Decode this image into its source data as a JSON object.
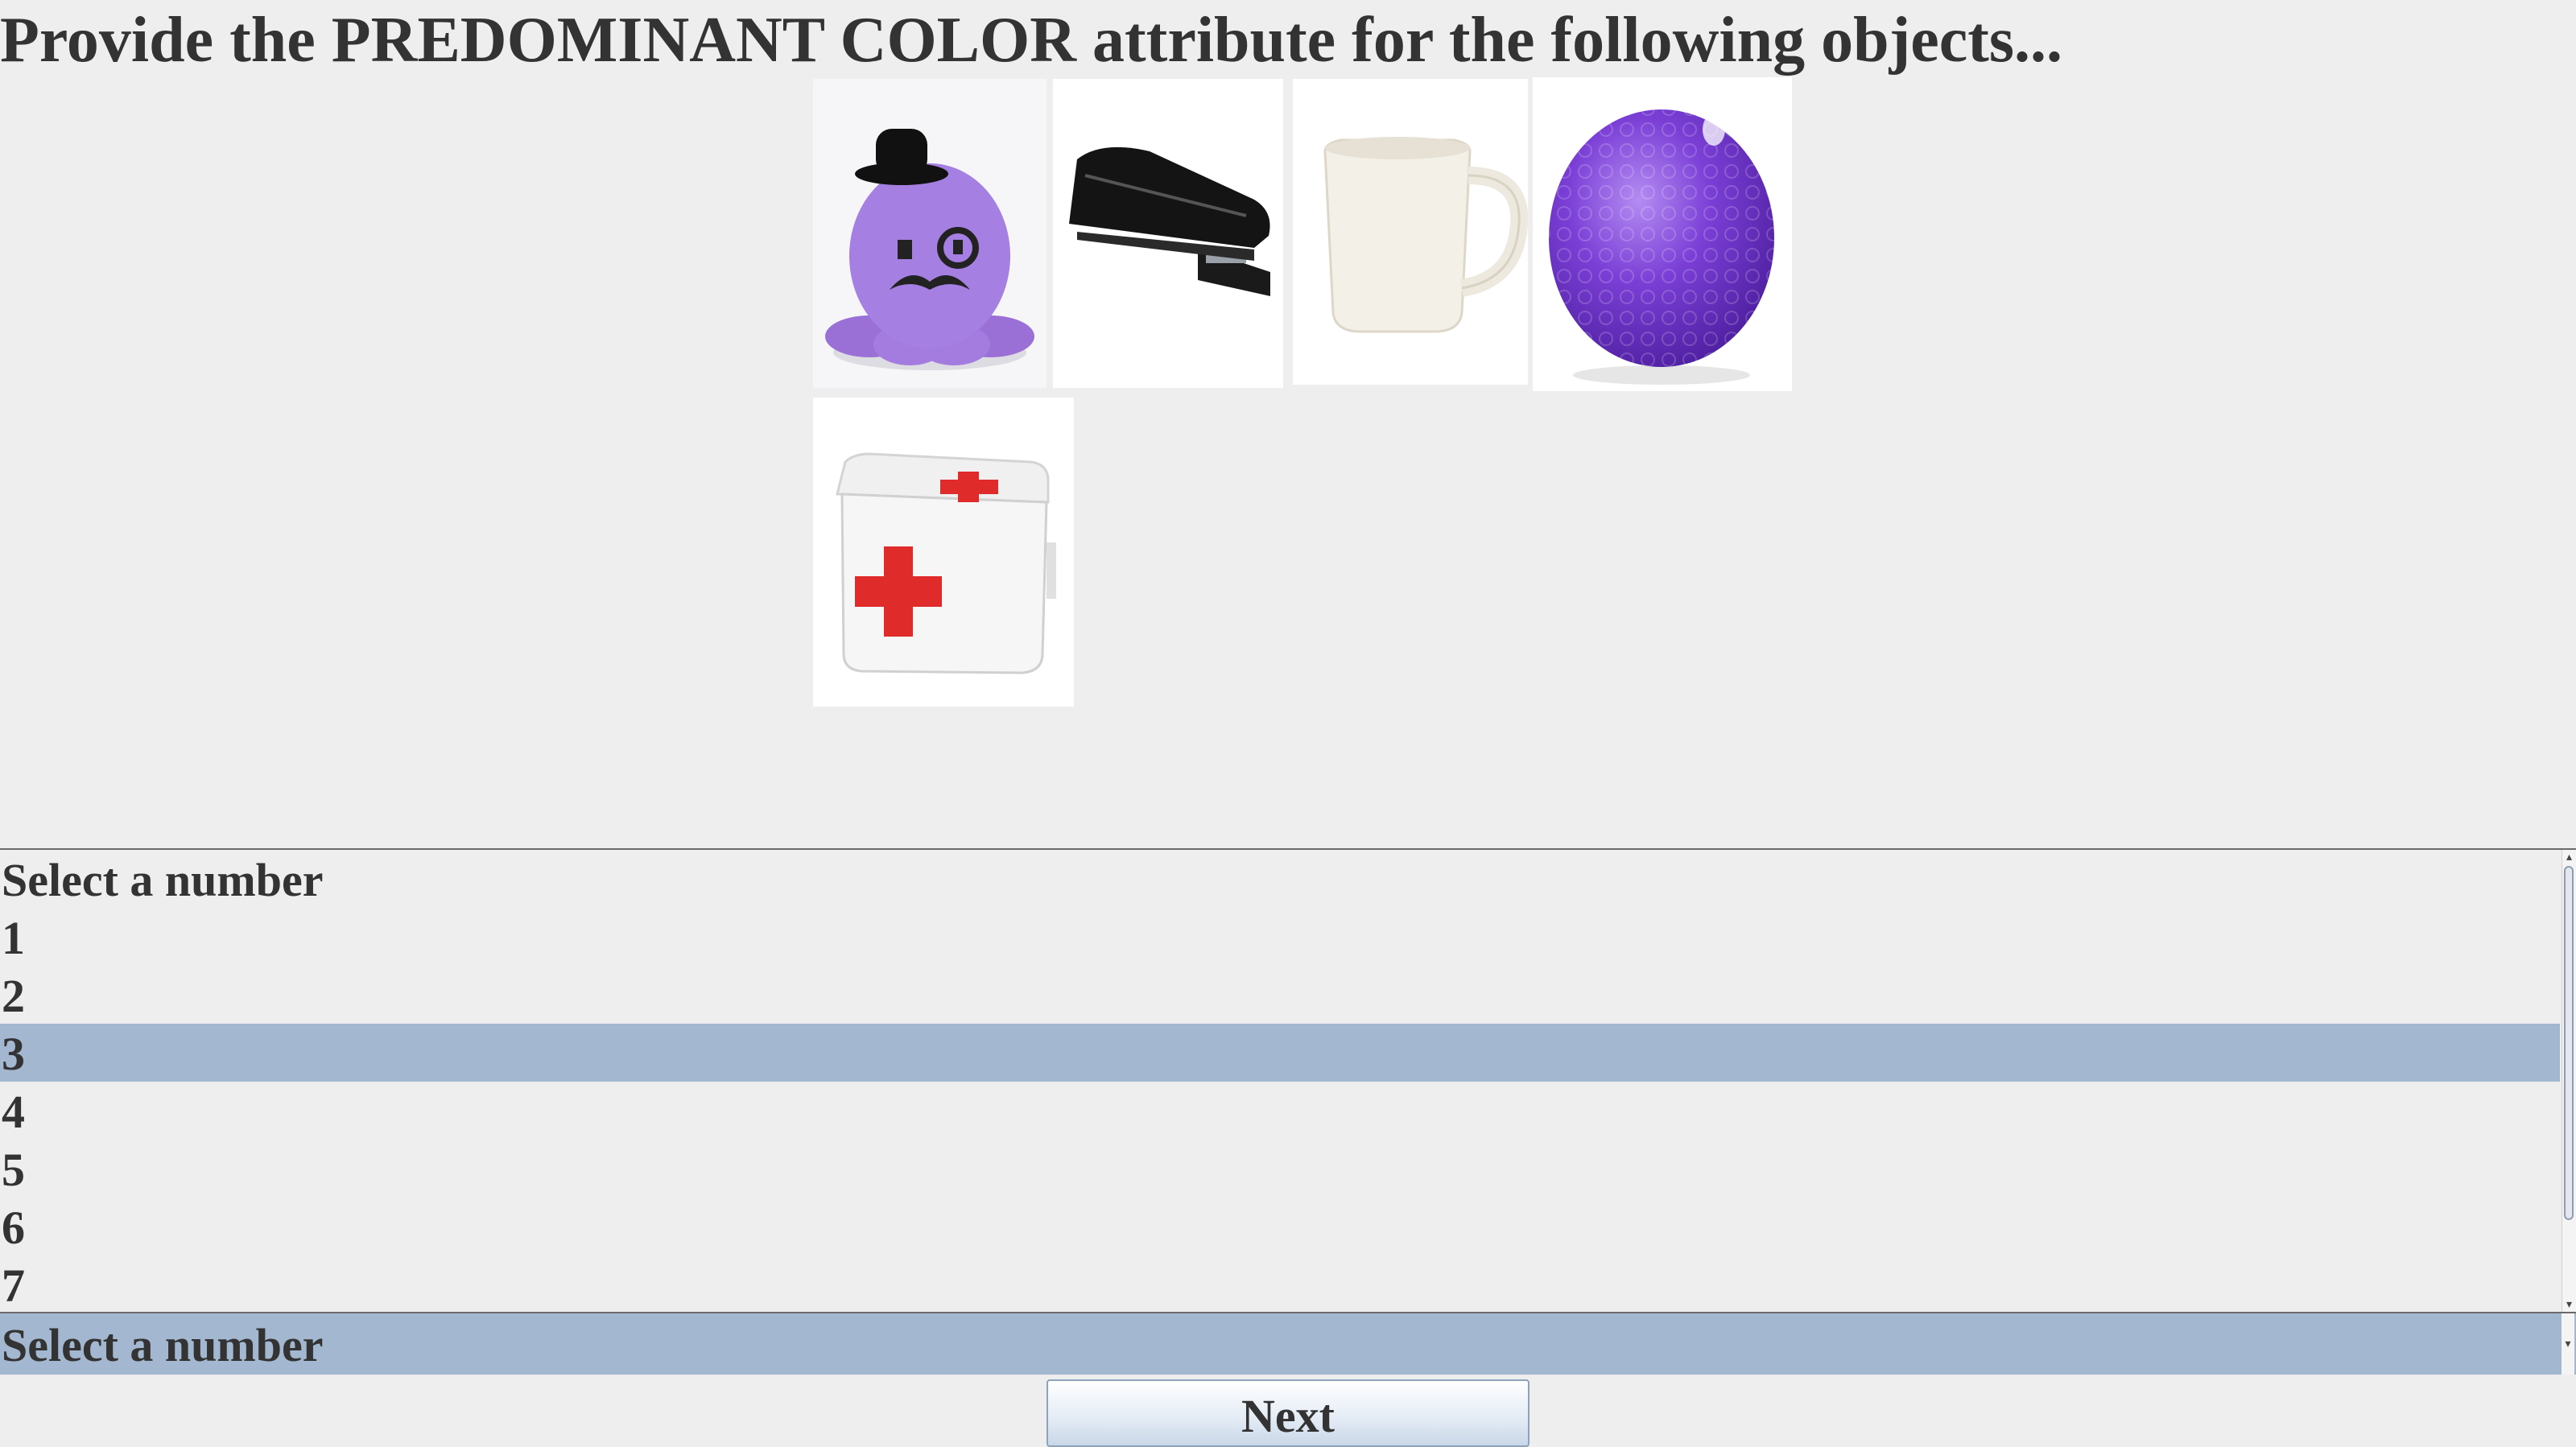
{
  "prompt": {
    "text": "Provide the PREDOMINANT COLOR attribute for the following objects..."
  },
  "objects": [
    {
      "icon": "purple-octopus-plush-icon"
    },
    {
      "icon": "black-stapler-icon"
    },
    {
      "icon": "white-mug-icon"
    },
    {
      "icon": "purple-golf-ball-icon"
    },
    {
      "icon": "first-aid-kit-icon"
    }
  ],
  "listbox": {
    "items": [
      {
        "label": "Select a number"
      },
      {
        "label": "1"
      },
      {
        "label": "2"
      },
      {
        "label": "3"
      },
      {
        "label": "4"
      },
      {
        "label": "5"
      },
      {
        "label": "6"
      },
      {
        "label": "7"
      }
    ],
    "selected_label": "3"
  },
  "dropdown": {
    "value": "Select a number"
  },
  "next_button": {
    "label": "Next"
  },
  "colors": {
    "background": "#eeeeee",
    "selection": "#a3b8d0",
    "text": "#333333"
  }
}
